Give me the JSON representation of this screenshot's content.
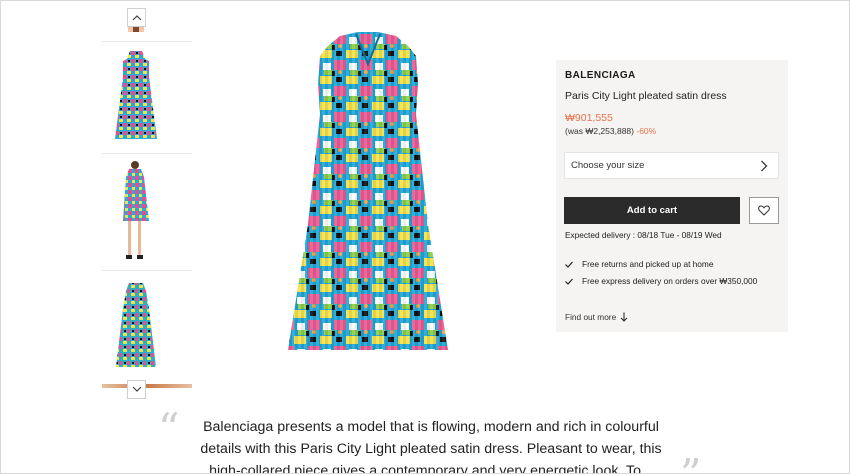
{
  "product": {
    "brand": "BALENCIAGA",
    "name": "Paris City Light pleated satin dress",
    "price": "₩901,555",
    "was_prefix": "(was ",
    "was_price": "₩2,253,888",
    "was_suffix": ")",
    "discount": "-60%",
    "size_placeholder": "Choose your size",
    "add_to_cart": "Add to cart",
    "delivery": "Expected delivery : 08/18 Tue - 08/19 Wed",
    "features": [
      "Free returns and picked up at home",
      "Free express delivery on orders over ₩350,000"
    ],
    "find_out_more": "Find out more"
  },
  "description": {
    "text": "Balenciaga presents a model that is flowing, modern and rich in colourful details with this Paris City Light pleated satin dress. Pleasant to wear, this high-collared piece gives a contemporary and very energetic look. To...",
    "quote_open": "“",
    "quote_close": "”"
  },
  "colors": {
    "accent": "#e8734e",
    "button_dark": "#2b2b2b",
    "panel_bg": "#f5f4f2"
  },
  "icons": [
    "chevron-up-icon",
    "chevron-down-icon",
    "chevron-right-icon",
    "heart-icon",
    "check-icon",
    "arrow-down-icon"
  ]
}
